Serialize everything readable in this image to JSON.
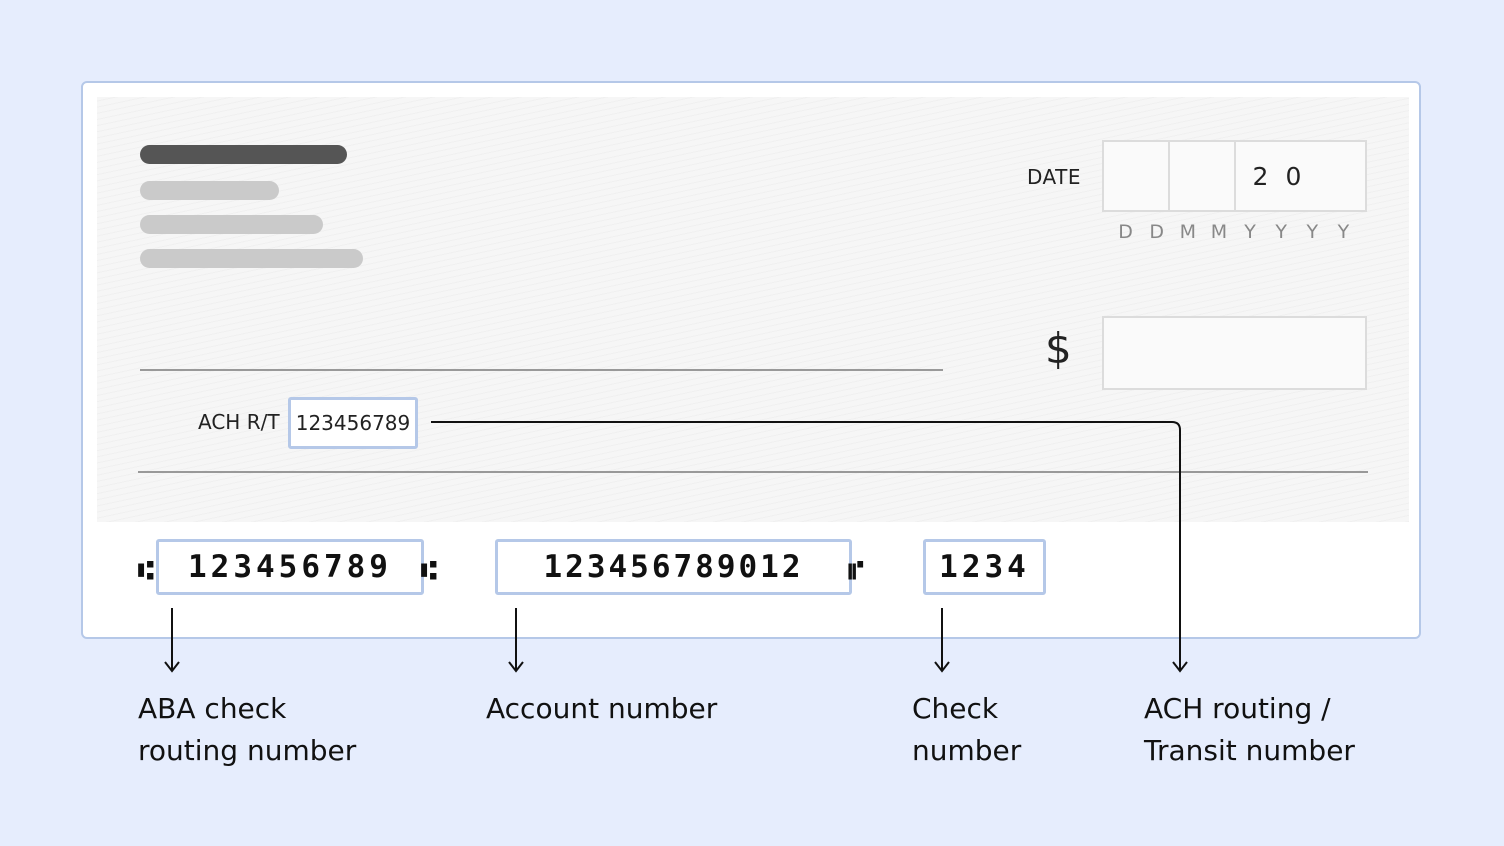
{
  "check": {
    "date_label": "DATE",
    "date_year_prefix": [
      "2",
      "0"
    ],
    "date_format": [
      "D",
      "D",
      "M",
      "M",
      "Y",
      "Y",
      "Y",
      "Y"
    ],
    "currency_symbol": "$",
    "ach_prefix": "ACH R/T",
    "ach_number": "123456789",
    "micr": {
      "routing_open": "⑆",
      "routing": "123456789",
      "routing_close": "⑆",
      "account": "123456789012",
      "account_end": "⑈",
      "check_number": "1234"
    }
  },
  "labels": {
    "routing": "ABA check\nrouting number",
    "account": "Account number",
    "check": "Check\nnumber",
    "ach": "ACH routing /\nTransit number"
  },
  "colors": {
    "background": "#e6edfd",
    "highlight_border": "#b5c8e8",
    "text": "#111111"
  }
}
